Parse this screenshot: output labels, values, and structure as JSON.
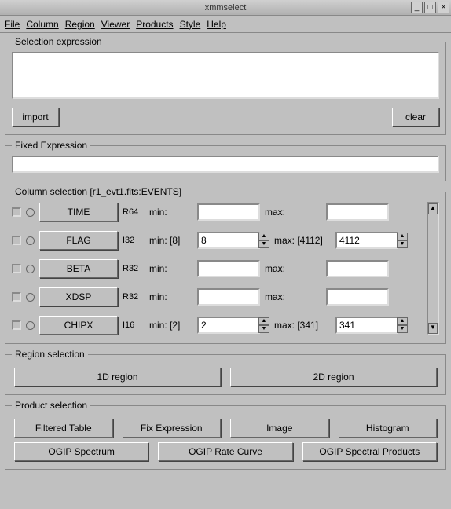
{
  "window": {
    "title": "xmmselect"
  },
  "menu": {
    "file": "File",
    "column": "Column",
    "region": "Region",
    "viewer": "Viewer",
    "products": "Products",
    "style": "Style",
    "help": "Help"
  },
  "selection": {
    "legend": "Selection expression",
    "value": "",
    "import": "import",
    "clear": "clear"
  },
  "fixed": {
    "legend": "Fixed Expression",
    "value": ""
  },
  "colsel": {
    "legend": "Column selection [r1_evt1.fits:EVENTS]",
    "rows": [
      {
        "name": "TIME",
        "type": "R64",
        "min_label": "min:",
        "max_label": "max:",
        "min_val": "",
        "max_val": "",
        "spin": false
      },
      {
        "name": "FLAG",
        "type": "I32",
        "min_label": "min: [8]",
        "max_label": "max: [4112]",
        "min_val": "8",
        "max_val": "4112",
        "spin": true
      },
      {
        "name": "BETA",
        "type": "R32",
        "min_label": "min:",
        "max_label": "max:",
        "min_val": "",
        "max_val": "",
        "spin": false
      },
      {
        "name": "XDSP",
        "type": "R32",
        "min_label": "min:",
        "max_label": "max:",
        "min_val": "",
        "max_val": "",
        "spin": false
      },
      {
        "name": "CHIPX",
        "type": "I16",
        "min_label": "min: [2]",
        "max_label": "max: [341]",
        "min_val": "2",
        "max_val": "341",
        "spin": true
      }
    ]
  },
  "region": {
    "legend": "Region selection",
    "r1d": "1D region",
    "r2d": "2D region"
  },
  "product": {
    "legend": "Product selection",
    "filtered": "Filtered Table",
    "fixexpr": "Fix Expression",
    "image": "Image",
    "histogram": "Histogram",
    "spectrum": "OGIP Spectrum",
    "ratecurve": "OGIP Rate Curve",
    "spectral": "OGIP Spectral Products"
  }
}
